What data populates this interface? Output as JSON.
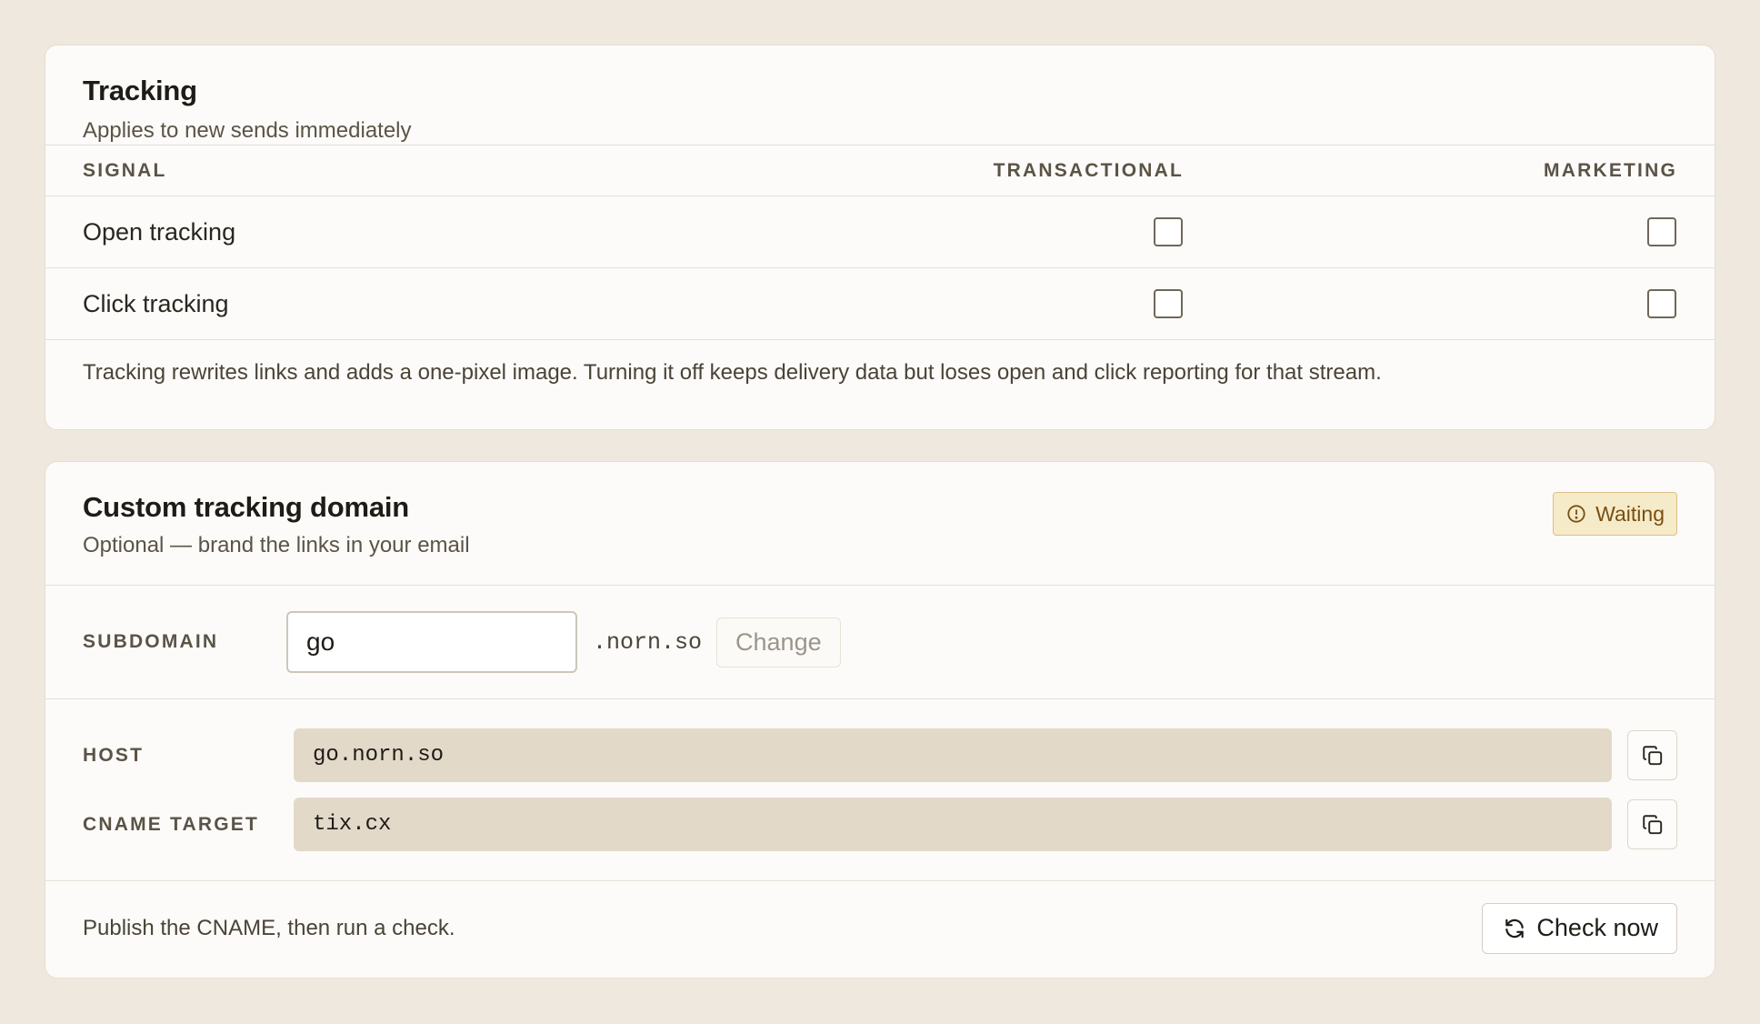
{
  "tracking": {
    "title": "Tracking",
    "subtitle": "Applies to new sends immediately",
    "columns": {
      "signal": "SIGNAL",
      "transactional": "TRANSACTIONAL",
      "marketing": "MARKETING"
    },
    "rows": [
      {
        "label": "Open tracking",
        "transactional": false,
        "marketing": false
      },
      {
        "label": "Click tracking",
        "transactional": false,
        "marketing": false
      }
    ],
    "note": "Tracking rewrites links and adds a one-pixel image. Turning it off keeps delivery data but loses open and click reporting for that stream."
  },
  "custom_domain": {
    "title": "Custom tracking domain",
    "subtitle": "Optional — brand the links in your email",
    "status": {
      "label": "Waiting",
      "icon": "alert-circle-icon",
      "color": "#7a4e12"
    },
    "subdomain": {
      "label": "SUBDOMAIN",
      "value": "go",
      "suffix": ".norn.so",
      "change_label": "Change"
    },
    "records": [
      {
        "label": "HOST",
        "value": "go.norn.so",
        "copy_icon": "copy-icon"
      },
      {
        "label": "CNAME TARGET",
        "value": "tix.cx",
        "copy_icon": "copy-icon"
      }
    ],
    "footer": {
      "text": "Publish the CNAME, then run a check.",
      "check_label": "Check now",
      "check_icon": "refresh-icon"
    }
  },
  "colors": {
    "background": "#eee8de",
    "card": "#fcfbf9",
    "badge_bg": "#f6ebc8",
    "record_bg": "#e2d9c9"
  }
}
